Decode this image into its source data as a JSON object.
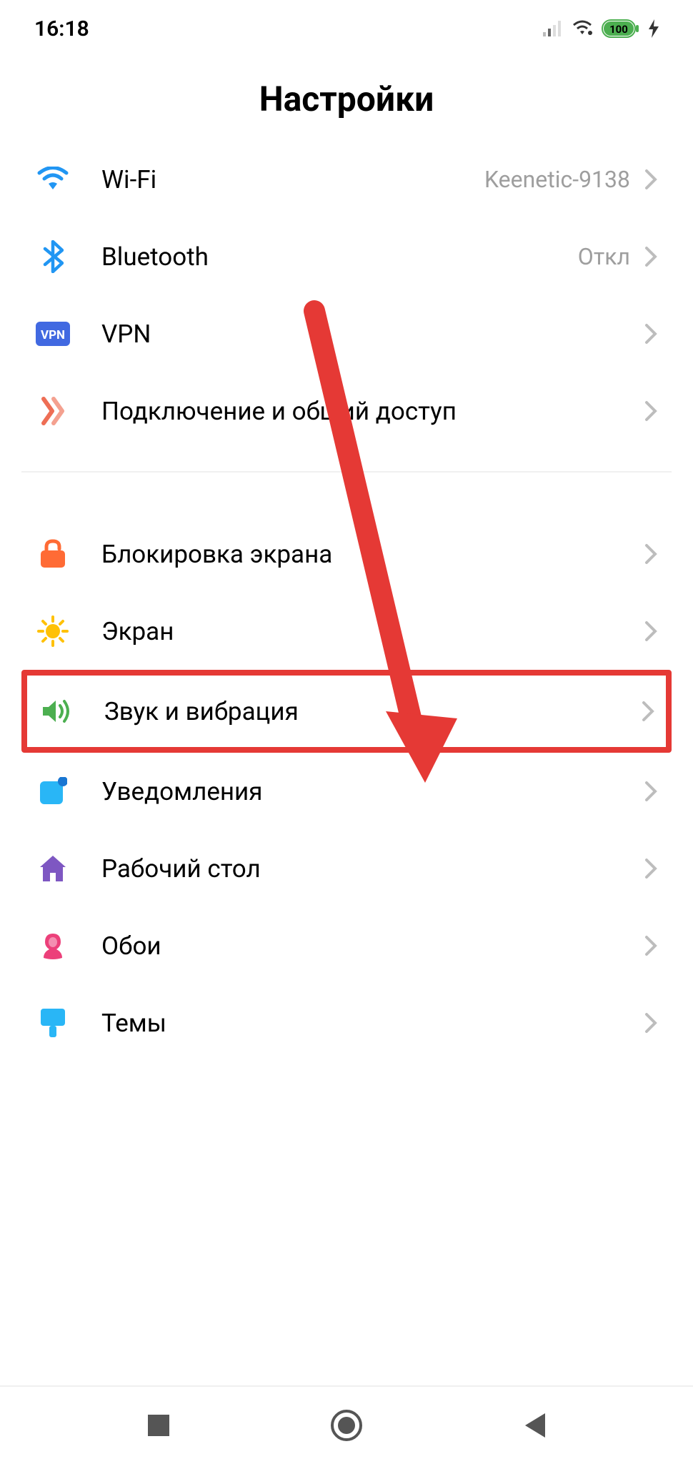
{
  "status": {
    "time": "16:18",
    "battery": "100"
  },
  "title": "Настройки",
  "group1": [
    {
      "icon": "wifi",
      "label": "Wi-Fi",
      "value": "Keenetic-9138"
    },
    {
      "icon": "bluetooth",
      "label": "Bluetooth",
      "value": "Откл"
    },
    {
      "icon": "vpn",
      "label": "VPN",
      "value": ""
    },
    {
      "icon": "tethering",
      "label": "Подключение и общий доступ",
      "value": ""
    }
  ],
  "group2": [
    {
      "icon": "lock",
      "label": "Блокировка экрана",
      "value": ""
    },
    {
      "icon": "brightness",
      "label": "Экран",
      "value": ""
    },
    {
      "icon": "sound",
      "label": "Звук и вибрация",
      "value": "",
      "highlighted": true
    },
    {
      "icon": "notifications",
      "label": "Уведомления",
      "value": ""
    },
    {
      "icon": "home",
      "label": "Рабочий стол",
      "value": ""
    },
    {
      "icon": "wallpaper",
      "label": "Обои",
      "value": ""
    },
    {
      "icon": "themes",
      "label": "Темы",
      "value": ""
    }
  ],
  "colors": {
    "wifi": "#2196f3",
    "bluetooth": "#2196f3",
    "vpn_bg": "#4169e1",
    "tethering": "#ee6e55",
    "lock": "#ff6b35",
    "brightness": "#ffc107",
    "sound": "#4caf50",
    "notifications": "#29b6f6",
    "home": "#7e57c2",
    "wallpaper": "#ec407a",
    "themes": "#29b6f6",
    "battery": "#4caf50",
    "annotation": "#e53935"
  }
}
